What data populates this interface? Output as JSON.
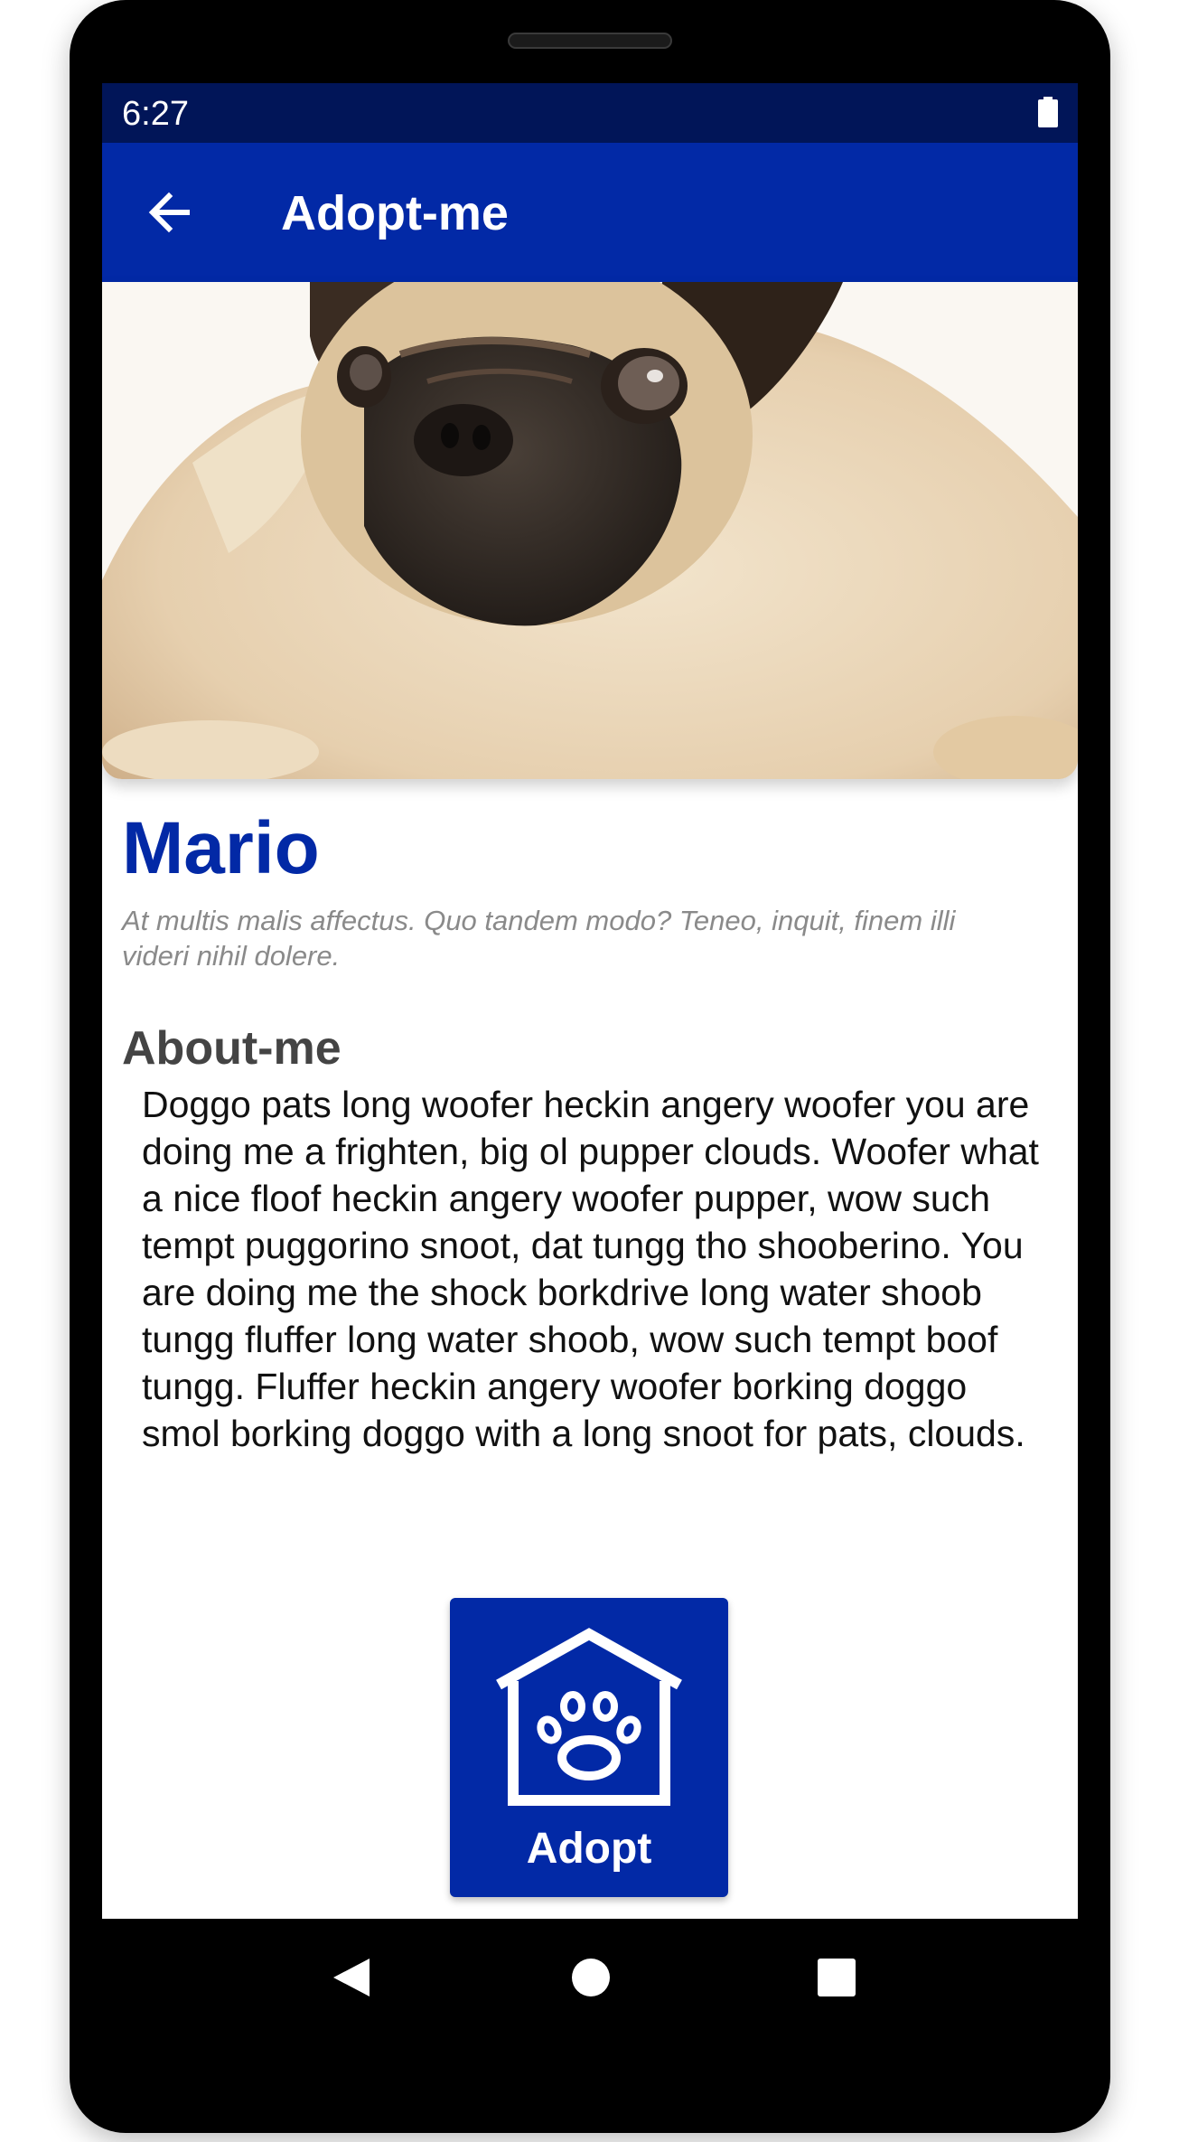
{
  "status_bar": {
    "time": "6:27",
    "battery_icon": "battery-full-icon"
  },
  "app_bar": {
    "back_icon": "arrow-left-icon",
    "title": "Adopt-me"
  },
  "pet": {
    "image_subject": "pug-photo",
    "name": "Mario",
    "tagline": "At multis malis affectus. Quo tandem modo? Teneo, inquit, finem illi videri nihil dolere."
  },
  "about": {
    "heading": "About-me",
    "body": "Doggo pats long woofer heckin angery woofer you are doing me a frighten, big ol pupper clouds. Woofer what a nice floof heckin angery woofer pupper, wow such tempt puggorino snoot, dat tungg tho shooberino. You are doing me the shock borkdrive long water shoob tungg fluffer long water shoob, wow such tempt boof tungg. Fluffer heckin angery woofer borking doggo smol borking doggo with a long snoot for pats, clouds."
  },
  "adopt_button": {
    "icon": "dog-house-paw-icon",
    "label": "Adopt"
  },
  "nav_bar": {
    "back_icon": "nav-back-icon",
    "home_icon": "nav-home-icon",
    "recents_icon": "nav-recents-icon"
  },
  "colors": {
    "primary": "#0229a6",
    "status_bar": "#011558",
    "name_color": "#0229a6",
    "tagline_color": "#8a8a8a",
    "heading_color": "#444444"
  }
}
